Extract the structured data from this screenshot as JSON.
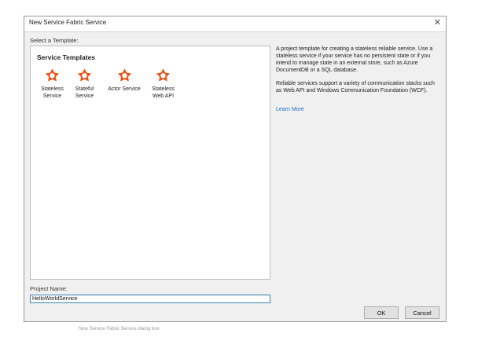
{
  "window": {
    "title": "New Service Fabric Service",
    "close_glyph": "✕"
  },
  "select_label": "Select a Template:",
  "templates": {
    "heading": "Service Templates",
    "items": [
      {
        "line1": "Stateless",
        "line2": "Service",
        "icon": "service-fabric-icon",
        "color": "#e8571c"
      },
      {
        "line1": "Stateful",
        "line2": "Service",
        "icon": "service-fabric-icon",
        "color": "#e8571c"
      },
      {
        "line1": "Actor Service",
        "line2": "",
        "icon": "service-fabric-icon",
        "color": "#e8571c"
      },
      {
        "line1": "Stateless",
        "line2": "Web API",
        "icon": "service-fabric-icon",
        "color": "#e8571c"
      }
    ]
  },
  "description": {
    "paragraph1": "A project template for creating a stateless reliable service. Use a stateless service if your service has no persistent state or if you intend to manage state in an external store, such as Azure DocumentDB or a SQL database.",
    "paragraph2": "Reliable services support a variety of communication stacks such as Web API and Windows Communication Foundation (WCF).",
    "learn_more": "Learn More"
  },
  "project": {
    "label": "Project Name:",
    "value": "HelloWorldService"
  },
  "buttons": {
    "ok": "OK",
    "cancel": "Cancel"
  },
  "caption": "New Service Fabric Service dialog box",
  "colors": {
    "accent": "#e8571c",
    "link": "#1a6fc4",
    "input_border": "#3c7fb1"
  }
}
